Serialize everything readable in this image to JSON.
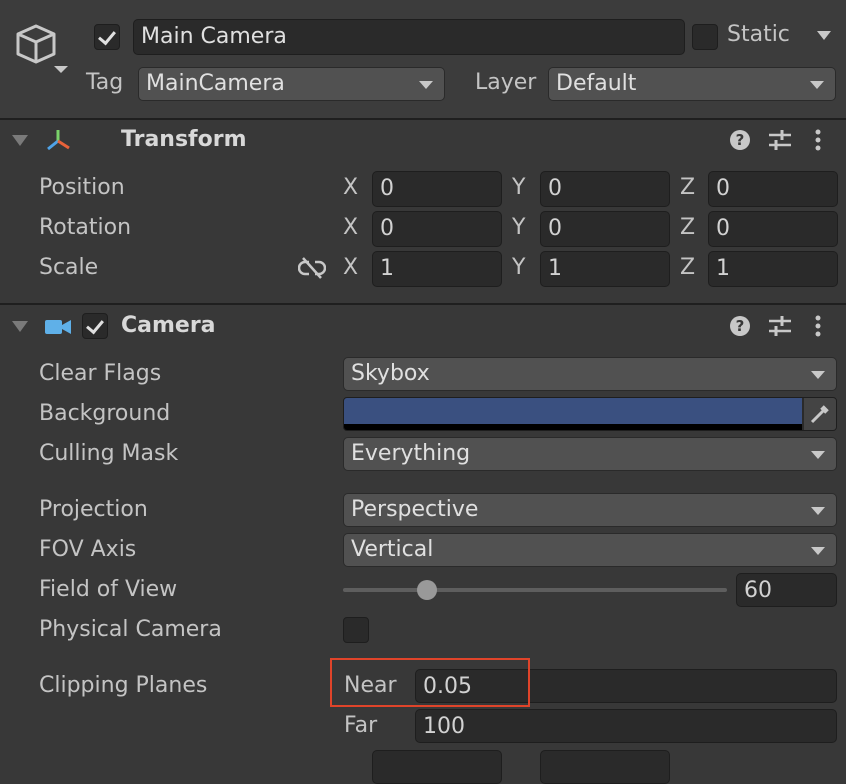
{
  "object": {
    "name": "Main Camera",
    "active": true,
    "static_label": "Static",
    "static_checked": false,
    "tag_label": "Tag",
    "tag_value": "MainCamera",
    "layer_label": "Layer",
    "layer_value": "Default"
  },
  "transform": {
    "title": "Transform",
    "rows": [
      {
        "label": "Position",
        "x": "0",
        "y": "0",
        "z": "0"
      },
      {
        "label": "Rotation",
        "x": "0",
        "y": "0",
        "z": "0"
      },
      {
        "label": "Scale",
        "x": "1",
        "y": "1",
        "z": "1"
      }
    ],
    "axes": {
      "x": "X",
      "y": "Y",
      "z": "Z"
    }
  },
  "camera": {
    "title": "Camera",
    "enabled": true,
    "clear_flags_label": "Clear Flags",
    "clear_flags_value": "Skybox",
    "background_label": "Background",
    "background_color": "#3a5080",
    "culling_mask_label": "Culling Mask",
    "culling_mask_value": "Everything",
    "projection_label": "Projection",
    "projection_value": "Perspective",
    "fov_axis_label": "FOV Axis",
    "fov_axis_value": "Vertical",
    "fov_label": "Field of View",
    "fov_value": "60",
    "fov_slider_fraction": 0.22,
    "physical_camera_label": "Physical Camera",
    "physical_camera_checked": false,
    "clipping_label": "Clipping Planes",
    "near_label": "Near",
    "near_value": "0.05",
    "far_label": "Far",
    "far_value": "100"
  },
  "highlight_color": "#e0442a",
  "icons": {
    "gameobject": "cube-icon",
    "transform": "transform-axes-icon",
    "camera": "camera-icon",
    "help": "help-icon",
    "presets": "presets-icon",
    "menu": "kebab-menu-icon",
    "constrain": "link-broken-icon",
    "eyedropper": "eyedropper-icon"
  }
}
